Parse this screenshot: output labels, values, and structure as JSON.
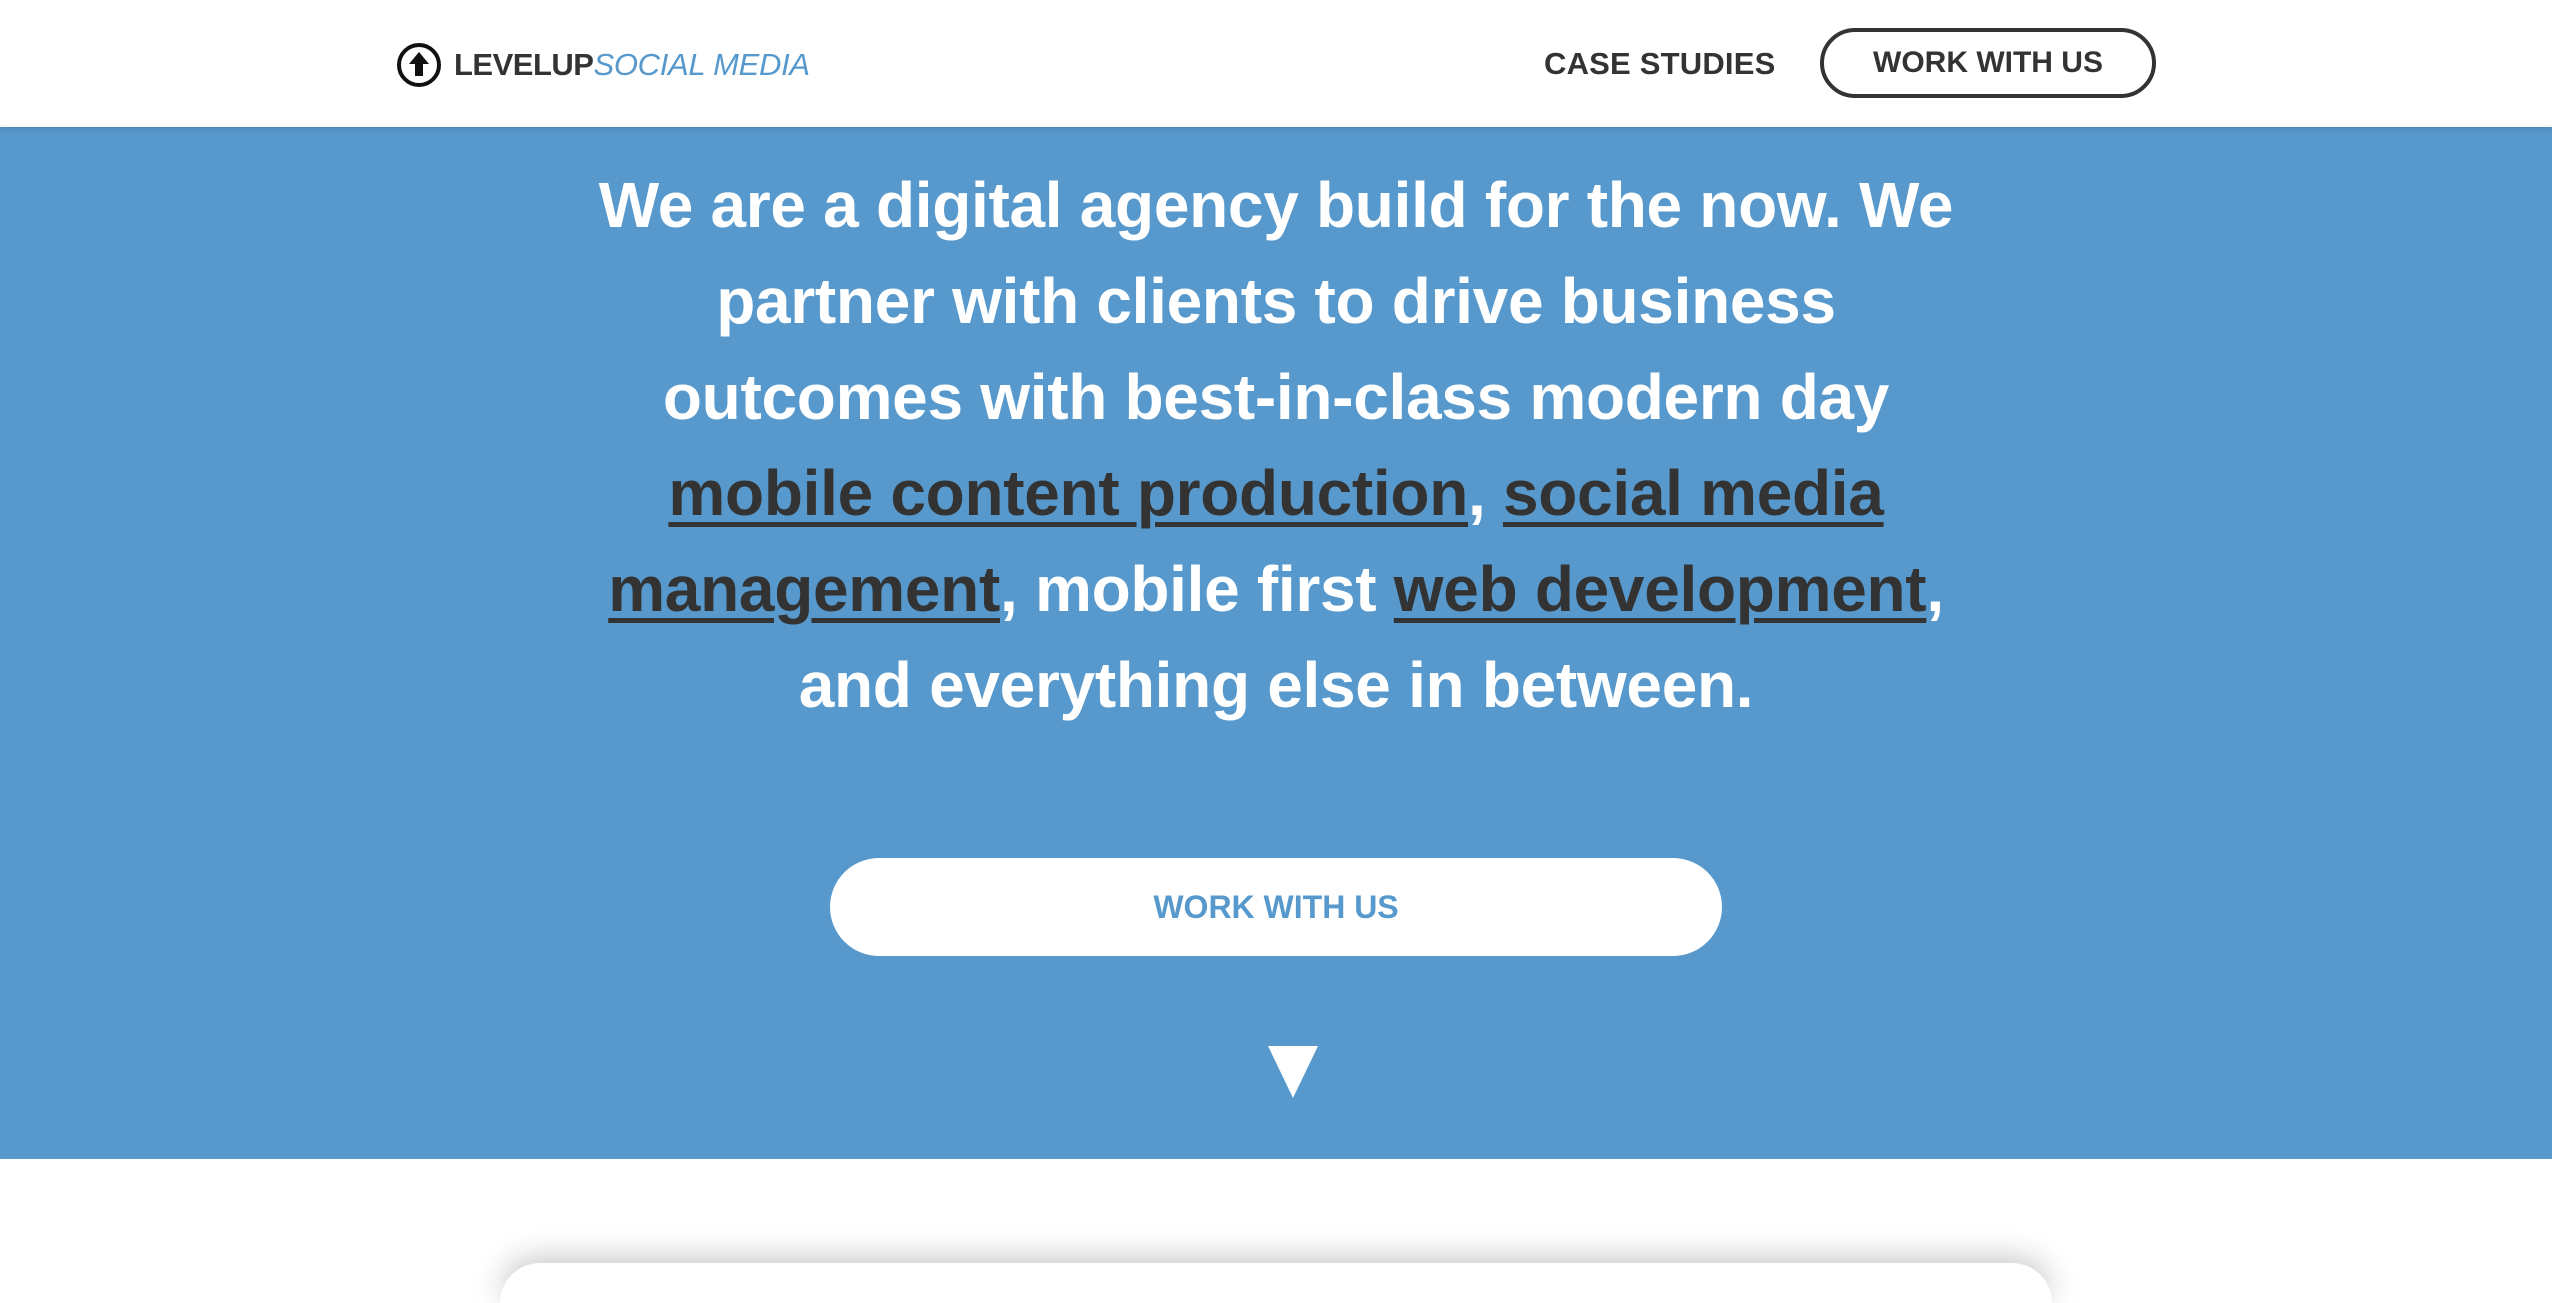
{
  "header": {
    "logo": {
      "strong": "LEVELUP",
      "italic": "SOCIAL MEDIA"
    },
    "nav": {
      "case_studies": "CASE STUDIES",
      "work_with_us": "WORK WITH US"
    }
  },
  "hero": {
    "text": {
      "part1": "We are a digital agency build for the now. We partner with clients to drive business outcomes with best-in-class modern day ",
      "link1": "mobile content production",
      "sep1": ", ",
      "link2": "social media management",
      "part2": ", mobile first ",
      "link3": "web development",
      "part3": ", and everything else in between."
    },
    "cta_label": "WORK WITH US"
  },
  "colors": {
    "brand_blue": "#5799cc",
    "dark_text": "#333333",
    "white": "#ffffff"
  },
  "icons": {
    "logo_icon": "arrow-up-circle-icon",
    "scroll_icon": "triangle-down-icon"
  }
}
